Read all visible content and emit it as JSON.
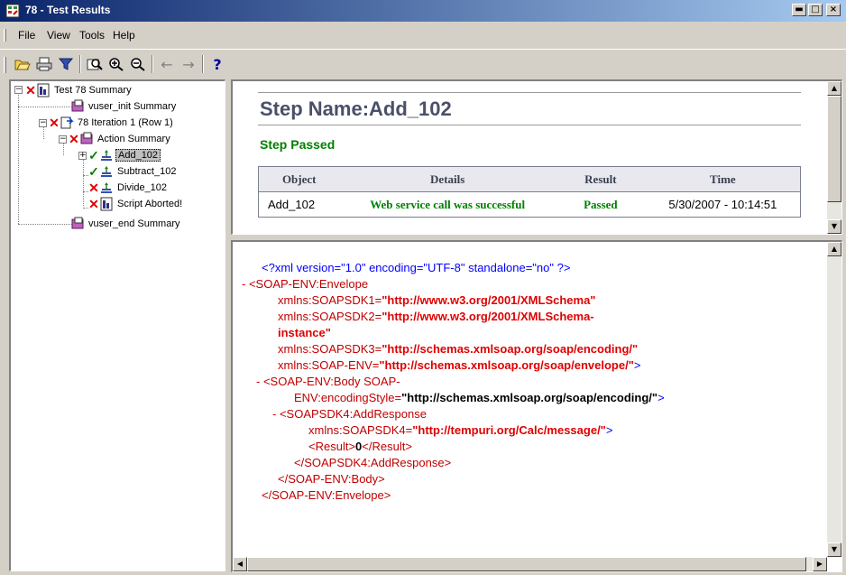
{
  "window": {
    "title": "78 - Test Results"
  },
  "menu": [
    "File",
    "View",
    "Tools",
    "Help"
  ],
  "toolbar": {
    "buttons": [
      "open-icon",
      "print-icon",
      "filter-icon",
      "find-icon",
      "zoom-in-icon",
      "zoom-out-icon",
      "back-icon",
      "forward-icon",
      "help-icon"
    ],
    "help_glyph": "?",
    "back_glyph": "←",
    "forward_glyph": "→"
  },
  "tree": {
    "root": "Test 78 Summary",
    "init": "vuser_init Summary",
    "iteration": "78 Iteration 1 (Row 1)",
    "action": "Action Summary",
    "steps": [
      "Add_102",
      "Subtract_102",
      "Divide_102",
      "Script Aborted!"
    ],
    "end": "vuser_end Summary"
  },
  "step": {
    "label": "Step Name:",
    "name": "Add_102",
    "status": "Step Passed"
  },
  "results_table": {
    "headers": [
      "Object",
      "Details",
      "Result",
      "Time"
    ],
    "rows": [
      {
        "object": "Add_102",
        "details": "Web service call was successful",
        "result": "Passed",
        "time": "5/30/2007 - 10:14:51"
      }
    ]
  },
  "xml": {
    "decl": "<?xml version=\"1.0\" encoding=\"UTF-8\" standalone=\"no\" ?>",
    "dash": "-",
    "envelope_open": "<SOAP-ENV:Envelope",
    "ns1_attr": "xmlns:SOAPSDK1=",
    "ns1_val": "\"http://www.w3.org/2001/XMLSchema\"",
    "ns2_attr": "xmlns:SOAPSDK2=",
    "ns2_val_a": "\"http://www.w3.org/2001/XMLSchema-",
    "ns2_val_b": "instance\"",
    "ns3_attr": "xmlns:SOAPSDK3=",
    "ns3_val": "\"http://schemas.xmlsoap.org/soap/encoding/\"",
    "nsenv_attr": "xmlns:SOAP-ENV=",
    "nsenv_val": "\"http://schemas.xmlsoap.org/soap/envelope/\"",
    "close_bracket": ">",
    "body_open": "<SOAP-ENV:Body SOAP-",
    "body_attr": "ENV:encodingStyle=",
    "body_val": "\"http://schemas.xmlsoap.org/soap/encoding/\"",
    "addresp_open": "<SOAPSDK4:AddResponse",
    "ns4_attr": "xmlns:SOAPSDK4=",
    "ns4_val": "\"http://tempuri.org/Calc/message/\"",
    "result_open": "<Result>",
    "result_val": "0",
    "result_close": "</Result>",
    "addresp_close": "</SOAPSDK4:AddResponse>",
    "body_close": "</SOAP-ENV:Body>",
    "envelope_close": "</SOAP-ENV:Envelope>"
  },
  "window_buttons": {
    "minimize": "▬",
    "maximize": "□",
    "close": "×"
  },
  "scroll_glyphs": {
    "up": "▲",
    "down": "▼",
    "left": "◀",
    "right": "▶"
  }
}
